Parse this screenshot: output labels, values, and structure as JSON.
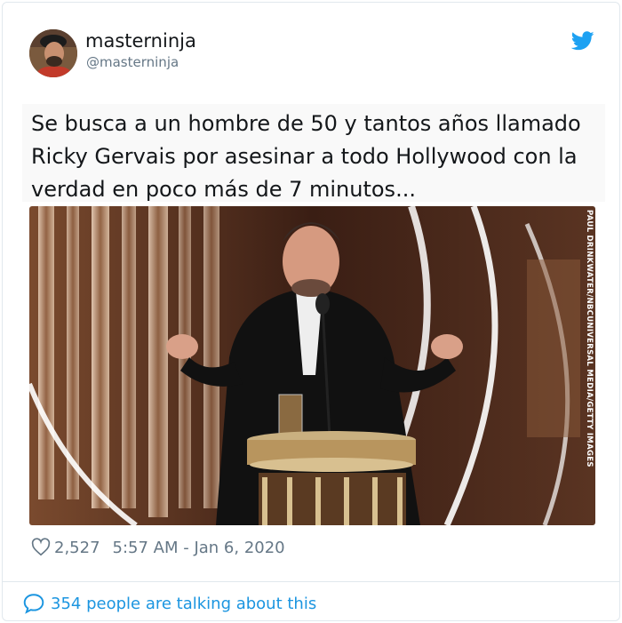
{
  "tweet": {
    "author": {
      "display_name": "masterninja",
      "handle": "@masterninja"
    },
    "text": "Se busca a un hombre de 50 y tantos años llamado Ricky Gervais por asesinar a todo Hollywood con la verdad en poco más de 7 minutos...",
    "image": {
      "credit": "PAUL DRINKWATER/NBCUNIVERSAL MEDIA/GETTY IMAGES"
    },
    "likes": "2,527",
    "timestamp": "5:57 AM - Jan 6, 2020",
    "conversation": "354 people are talking about this"
  },
  "colors": {
    "brand": "#1da1f2",
    "link": "#1b95e0",
    "secondary_text": "#657786",
    "border": "#e1e8ed"
  },
  "icons": {
    "brand": "twitter-bird-icon",
    "like": "heart-outline-icon",
    "reply": "speech-bubble-icon"
  }
}
